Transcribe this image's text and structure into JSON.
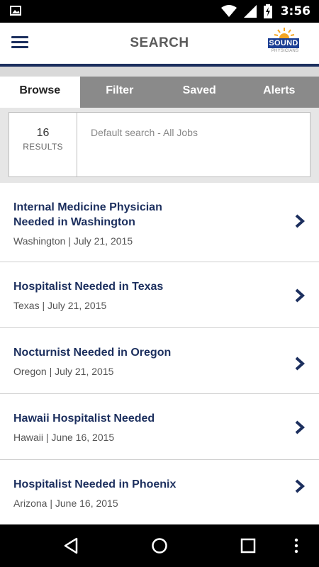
{
  "status_bar": {
    "time": "3:56",
    "icons": [
      "gallery-icon",
      "wifi-icon",
      "signal-icon",
      "battery-charging-icon"
    ]
  },
  "header": {
    "title": "SEARCH",
    "logo": {
      "brand": "SOUND",
      "sub": "PHYSICIANS"
    },
    "accent_color": "#1c2f5e"
  },
  "tabs": [
    {
      "label": "Browse",
      "active": true
    },
    {
      "label": "Filter",
      "active": false
    },
    {
      "label": "Saved",
      "active": false
    },
    {
      "label": "Alerts",
      "active": false
    }
  ],
  "summary": {
    "count": "16",
    "count_label": "RESULTS",
    "description": "Default search - All Jobs"
  },
  "jobs": [
    {
      "title": "Internal Medicine Physician Needed in Washington",
      "meta": "Washington | July 21, 2015"
    },
    {
      "title": "Hospitalist Needed in Texas",
      "meta": "Texas | July 21, 2015"
    },
    {
      "title": "Nocturnist Needed in Oregon",
      "meta": "Oregon | July 21, 2015"
    },
    {
      "title": "Hawaii Hospitalist Needed",
      "meta": "Hawaii | June 16, 2015"
    },
    {
      "title": "Hospitalist Needed in Phoenix",
      "meta": "Arizona | June 16, 2015"
    }
  ],
  "nav_bar": {
    "icons": [
      "back-icon",
      "home-icon",
      "recents-icon",
      "more-icon"
    ]
  }
}
